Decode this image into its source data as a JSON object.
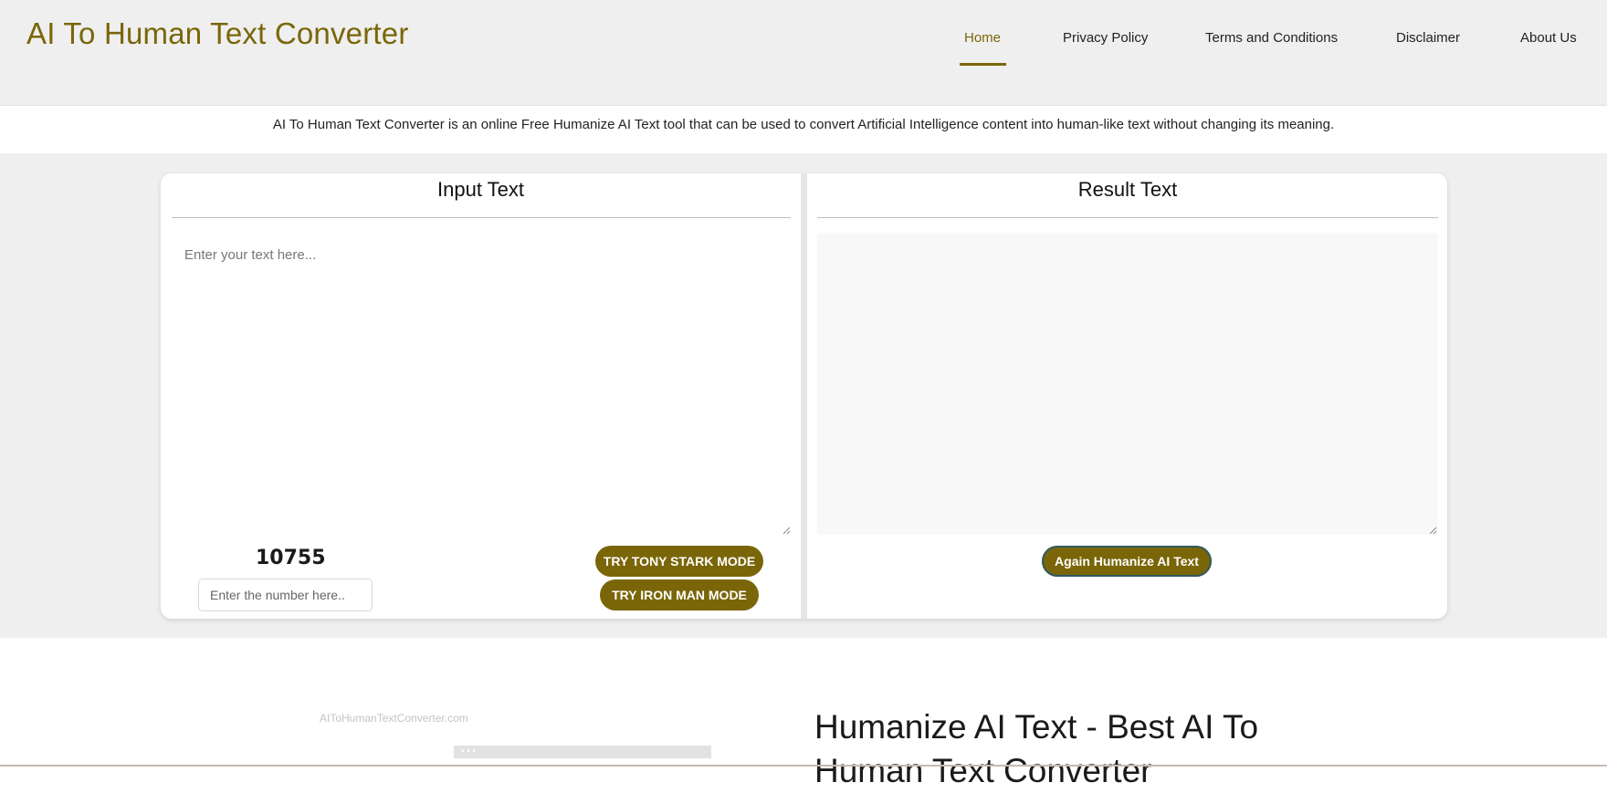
{
  "header": {
    "brand": "AI To Human Text Converter",
    "nav": [
      {
        "label": "Home",
        "active": true
      },
      {
        "label": "Privacy Policy"
      },
      {
        "label": "Terms and Conditions"
      },
      {
        "label": "Disclaimer"
      },
      {
        "label": "About Us"
      }
    ]
  },
  "intro": {
    "text": "AI To Human Text Converter is an online Free Humanize AI Text tool that can be used to convert Artificial Intelligence content into human-like text without changing its meaning."
  },
  "input_panel": {
    "title": "Input Text",
    "placeholder": "Enter your text here...",
    "counter": "10755",
    "number_placeholder": "Enter the number here..",
    "btn_tony": "TRY TONY STARK MODE",
    "btn_iron": "TRY IRON MAN MODE"
  },
  "result_panel": {
    "title": "Result Text",
    "btn_again": "Again Humanize AI Text"
  },
  "lower": {
    "caption": "AIToHumanTextConverter.com",
    "bar_dots": "• • •",
    "heading": "Humanize AI Text - Best AI To Human Text Converter"
  },
  "colors": {
    "accent": "#7a6608",
    "header_bg": "#efefef"
  }
}
